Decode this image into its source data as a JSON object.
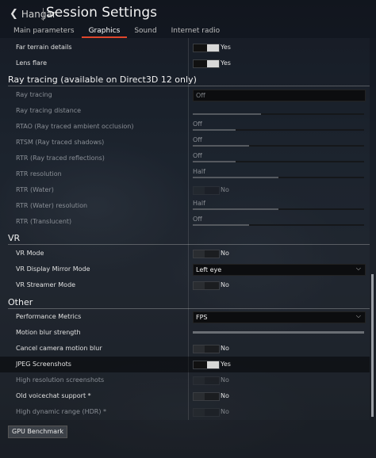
{
  "header": {
    "back_label": "Hangar",
    "back_icon": "chevron-left",
    "title": "Session Settings"
  },
  "tabs": [
    "Main parameters",
    "Graphics",
    "Sound",
    "Internet radio"
  ],
  "active_tab": "Graphics",
  "top_rows": [
    {
      "label": "Far terrain details",
      "toggle": "on",
      "value": "Yes"
    },
    {
      "label": "Lens flare",
      "toggle": "on",
      "value": "Yes"
    }
  ],
  "sections": {
    "ray_tracing": "Ray tracing (available on Direct3D 12 only)",
    "vr": "VR",
    "other": "Other"
  },
  "ray_tracing_rows": [
    {
      "label": "Ray tracing",
      "type": "select",
      "value": "Off",
      "dim": true
    },
    {
      "label": "Ray tracing distance",
      "type": "slider",
      "level": 0.4,
      "dim": true
    },
    {
      "label": "RTAO (Ray traced ambient occlusion)",
      "type": "slider",
      "value": "Off",
      "level": 0.25,
      "dim": true
    },
    {
      "label": "RTSM (Ray traced shadows)",
      "type": "slider",
      "value": "Off",
      "level": 0.33,
      "dim": true
    },
    {
      "label": "RTR (Ray traced reflections)",
      "type": "slider",
      "value": "Off",
      "level": 0.25,
      "dim": true
    },
    {
      "label": "RTR resolution",
      "type": "slider",
      "value": "Half",
      "level": 0.5,
      "dim": true
    },
    {
      "label": "RTR (Water)",
      "type": "toggle",
      "toggle": "off",
      "value": "No",
      "dim": true
    },
    {
      "label": "RTR (Water) resolution",
      "type": "slider",
      "value": "Half",
      "level": 0.5,
      "dim": true
    },
    {
      "label": "RTR (Translucent)",
      "type": "slider",
      "value": "Off",
      "level": 0.33,
      "dim": true
    }
  ],
  "vr_rows": [
    {
      "label": "VR Mode",
      "type": "toggle",
      "toggle": "off",
      "value": "No"
    },
    {
      "label": "VR Display Mirror Mode",
      "type": "select",
      "value": "Left eye"
    },
    {
      "label": "VR Streamer Mode",
      "type": "toggle",
      "toggle": "off",
      "value": "No"
    }
  ],
  "other_rows": [
    {
      "label": "Performance Metrics",
      "type": "select",
      "value": "FPS"
    },
    {
      "label": "Motion blur strength",
      "type": "fullbar"
    },
    {
      "label": "Cancel camera motion blur",
      "type": "toggle",
      "toggle": "off",
      "value": "No"
    },
    {
      "label": "JPEG Screenshots",
      "type": "toggle",
      "toggle": "on",
      "value": "Yes",
      "highlight": true
    },
    {
      "label": "High resolution screenshots",
      "type": "toggle",
      "toggle": "off",
      "value": "No",
      "dim": true
    },
    {
      "label": "Old voicechat support *",
      "type": "toggle",
      "toggle": "off",
      "value": "No"
    },
    {
      "label": "High dynamic range (HDR) *",
      "type": "toggle",
      "toggle": "off",
      "value": "No",
      "dim": true
    }
  ],
  "footer": {
    "benchmark_label": "GPU Benchmark"
  },
  "chevron_glyph": "⌵",
  "back_glyph": "❮"
}
